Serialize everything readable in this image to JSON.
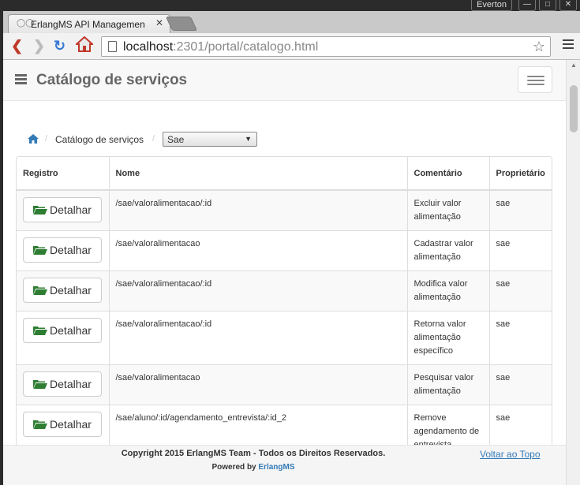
{
  "os": {
    "user": "Everton",
    "window_controls": [
      "minimize-icon",
      "maximize-icon",
      "close-icon"
    ]
  },
  "browser": {
    "tab_title": "ErlangMS API Managemen",
    "url_host": "localhost",
    "url_rest": ":2301/portal/catalogo.html"
  },
  "navbar": {
    "brand": "Catálogo de serviços"
  },
  "breadcrumb": {
    "current": "Catálogo de serviços",
    "separator": "/",
    "selected": "Sae"
  },
  "table": {
    "headers": [
      "Registro",
      "Nome",
      "Comentário",
      "Proprietário"
    ],
    "button_label": "Detalhar",
    "rows": [
      {
        "nome": "/sae/valoralimentacao/:id",
        "comentario": "Excluir valor alimentação",
        "proprietario": "sae"
      },
      {
        "nome": "/sae/valoralimentacao",
        "comentario": "Cadastrar valor alimentação",
        "proprietario": "sae"
      },
      {
        "nome": "/sae/valoralimentacao/:id",
        "comentario": "Modifica valor alimentação",
        "proprietario": "sae"
      },
      {
        "nome": "/sae/valoralimentacao/:id",
        "comentario": "Retorna valor alimentação específico",
        "proprietario": "sae"
      },
      {
        "nome": "/sae/valoralimentacao",
        "comentario": "Pesquisar valor alimentação",
        "proprietario": "sae"
      },
      {
        "nome": "/sae/aluno/:id/agendamento_entrevista/:id_2",
        "comentario": "Remove agendamento de entrevista",
        "proprietario": "sae"
      }
    ]
  },
  "footer": {
    "copyright": "Copyright 2015 ErlangMS Team - Todos os Direitos Reservados.",
    "powered_prefix": "Powered by ",
    "powered_link": "ErlangMS",
    "top_link": "Voltar ao Topo"
  },
  "colors": {
    "link": "#337ab7",
    "folder_icon": "#2e7d32"
  }
}
